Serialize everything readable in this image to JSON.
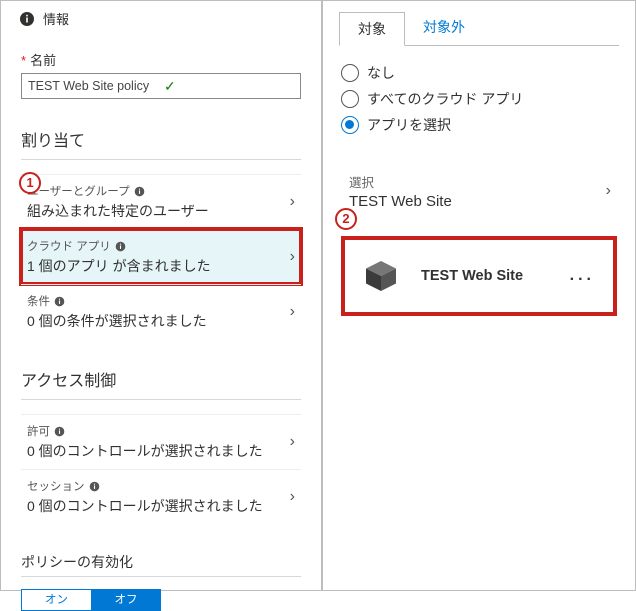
{
  "left": {
    "title": "情報",
    "name": {
      "label": "名前",
      "value": "TEST Web Site policy"
    },
    "assign": {
      "heading": "割り当て",
      "items": [
        {
          "label": "ユーザーとグループ",
          "sub": "組み込まれた特定のユーザー",
          "badge": "1"
        },
        {
          "label": "クラウド アプリ",
          "sub": "1 個のアプリ が含まれました"
        },
        {
          "label": "条件",
          "sub": "0 個の条件が選択されました"
        }
      ]
    },
    "access": {
      "heading": "アクセス制御",
      "items": [
        {
          "label": "許可",
          "sub": "0 個のコントロールが選択されました"
        },
        {
          "label": "セッション",
          "sub": "0 個のコントロールが選択されました"
        }
      ]
    },
    "enable": {
      "heading": "ポリシーの有効化",
      "on": "オン",
      "off": "オフ"
    }
  },
  "right": {
    "tabs": {
      "include": "対象",
      "exclude": "対象外"
    },
    "radios": {
      "none": "なし",
      "all": "すべてのクラウド アプリ",
      "sel": "アプリを選択"
    },
    "choose": {
      "label": "選択",
      "value": "TEST Web Site",
      "badge": "2"
    },
    "app": {
      "name": "TEST Web Site"
    }
  }
}
